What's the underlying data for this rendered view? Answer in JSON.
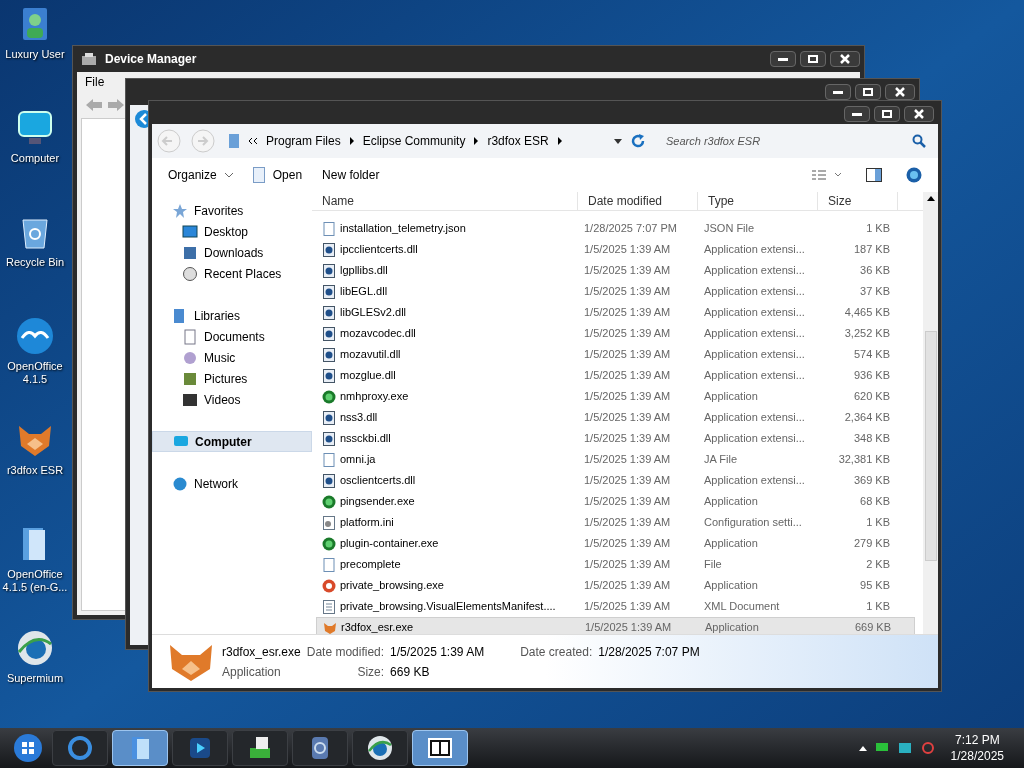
{
  "desktop_icons": [
    {
      "label": "Luxury User",
      "kind": "user"
    },
    {
      "label": "Computer",
      "kind": "computer"
    },
    {
      "label": "Recycle Bin",
      "kind": "bin"
    },
    {
      "label": "OpenOffice 4.1.5",
      "kind": "gull"
    },
    {
      "label": "r3dfox ESR",
      "kind": "fox"
    },
    {
      "label": "OpenOffice 4.1.5 (en-G...",
      "kind": "folder"
    },
    {
      "label": "Supermium",
      "kind": "globe"
    }
  ],
  "device_manager": {
    "title": "Device Manager",
    "menu": [
      "File"
    ]
  },
  "explorer": {
    "address": [
      "Program Files",
      "Eclipse Community",
      "r3dfox ESR"
    ],
    "search": {
      "placeholder": "Search r3dfox ESR"
    },
    "toolbar": {
      "organize": "Organize",
      "open": "Open",
      "new_folder": "New folder"
    },
    "nav": [
      {
        "label": "Favorites",
        "kind": "star",
        "group": true,
        "selected": false
      },
      {
        "label": "Desktop",
        "kind": "desktop",
        "group": false,
        "selected": false
      },
      {
        "label": "Downloads",
        "kind": "download",
        "group": false,
        "selected": false
      },
      {
        "label": "Recent Places",
        "kind": "recent",
        "group": false,
        "selected": false
      },
      {
        "label": "Libraries",
        "kind": "library",
        "group": true,
        "selected": false
      },
      {
        "label": "Documents",
        "kind": "docs",
        "group": false,
        "selected": false
      },
      {
        "label": "Music",
        "kind": "music",
        "group": false,
        "selected": false
      },
      {
        "label": "Pictures",
        "kind": "pictures",
        "group": false,
        "selected": false
      },
      {
        "label": "Videos",
        "kind": "videos",
        "group": false,
        "selected": false
      },
      {
        "label": "Computer",
        "kind": "computer",
        "group": true,
        "selected": true
      },
      {
        "label": "Network",
        "kind": "network",
        "group": true,
        "selected": false
      }
    ],
    "columns": [
      "Name",
      "Date modified",
      "Type",
      "Size"
    ],
    "rows": [
      {
        "name": "installation_telemetry.json",
        "date": "1/28/2025 7:07 PM",
        "type": "JSON File",
        "size": "1 KB",
        "kind": "document",
        "selected": false
      },
      {
        "name": "ipcclientcerts.dll",
        "date": "1/5/2025 1:39 AM",
        "type": "Application extensi...",
        "size": "187 KB",
        "kind": "library",
        "selected": false
      },
      {
        "name": "lgpllibs.dll",
        "date": "1/5/2025 1:39 AM",
        "type": "Application extensi...",
        "size": "36 KB",
        "kind": "library",
        "selected": false
      },
      {
        "name": "libEGL.dll",
        "date": "1/5/2025 1:39 AM",
        "type": "Application extensi...",
        "size": "37 KB",
        "kind": "library",
        "selected": false
      },
      {
        "name": "libGLESv2.dll",
        "date": "1/5/2025 1:39 AM",
        "type": "Application extensi...",
        "size": "4,465 KB",
        "kind": "library",
        "selected": false
      },
      {
        "name": "mozavcodec.dll",
        "date": "1/5/2025 1:39 AM",
        "type": "Application extensi...",
        "size": "3,252 KB",
        "kind": "library",
        "selected": false
      },
      {
        "name": "mozavutil.dll",
        "date": "1/5/2025 1:39 AM",
        "type": "Application extensi...",
        "size": "574 KB",
        "kind": "library",
        "selected": false
      },
      {
        "name": "mozglue.dll",
        "date": "1/5/2025 1:39 AM",
        "type": "Application extensi...",
        "size": "936 KB",
        "kind": "library",
        "selected": false
      },
      {
        "name": "nmhproxy.exe",
        "date": "1/5/2025 1:39 AM",
        "type": "Application",
        "size": "620 KB",
        "kind": "program",
        "selected": false
      },
      {
        "name": "nss3.dll",
        "date": "1/5/2025 1:39 AM",
        "type": "Application extensi...",
        "size": "2,364 KB",
        "kind": "library",
        "selected": false
      },
      {
        "name": "nssckbi.dll",
        "date": "1/5/2025 1:39 AM",
        "type": "Application extensi...",
        "size": "348 KB",
        "kind": "library",
        "selected": false
      },
      {
        "name": "omni.ja",
        "date": "1/5/2025 1:39 AM",
        "type": "JA File",
        "size": "32,381 KB",
        "kind": "document",
        "selected": false
      },
      {
        "name": "osclientcerts.dll",
        "date": "1/5/2025 1:39 AM",
        "type": "Application extensi...",
        "size": "369 KB",
        "kind": "library",
        "selected": false
      },
      {
        "name": "pingsender.exe",
        "date": "1/5/2025 1:39 AM",
        "type": "Application",
        "size": "68 KB",
        "kind": "program",
        "selected": false
      },
      {
        "name": "platform.ini",
        "date": "1/5/2025 1:39 AM",
        "type": "Configuration setti...",
        "size": "1 KB",
        "kind": "settings",
        "selected": false
      },
      {
        "name": "plugin-container.exe",
        "date": "1/5/2025 1:39 AM",
        "type": "Application",
        "size": "279 KB",
        "kind": "program",
        "selected": false
      },
      {
        "name": "precomplete",
        "date": "1/5/2025 1:39 AM",
        "type": "File",
        "size": "2 KB",
        "kind": "document",
        "selected": false
      },
      {
        "name": "private_browsing.exe",
        "date": "1/5/2025 1:39 AM",
        "type": "Application",
        "size": "95 KB",
        "kind": "private",
        "selected": false
      },
      {
        "name": "private_browsing.VisualElementsManifest....",
        "date": "1/5/2025 1:39 AM",
        "type": "XML Document",
        "size": "1 KB",
        "kind": "xml",
        "selected": false
      },
      {
        "name": "r3dfox_esr.exe",
        "date": "1/5/2025 1:39 AM",
        "type": "Application",
        "size": "669 KB",
        "kind": "fox",
        "selected": true
      }
    ],
    "details": {
      "name": "r3dfox_esr.exe",
      "type": "Application",
      "modified_label": "Date modified:",
      "modified": "1/5/2025 1:39 AM",
      "created_label": "Date created:",
      "created": "1/28/2025 7:07 PM",
      "size_label": "Size:",
      "size": "669 KB"
    }
  },
  "taskbar": {
    "items": [
      {
        "kind": "browser",
        "active": false
      },
      {
        "kind": "folder",
        "active": true
      },
      {
        "kind": "media",
        "active": false
      },
      {
        "kind": "installer",
        "active": false
      },
      {
        "kind": "disc",
        "active": false
      },
      {
        "kind": "globe",
        "active": false
      },
      {
        "kind": "archive",
        "active": true
      }
    ],
    "time": "7:12 PM",
    "date": "1/28/2025"
  }
}
